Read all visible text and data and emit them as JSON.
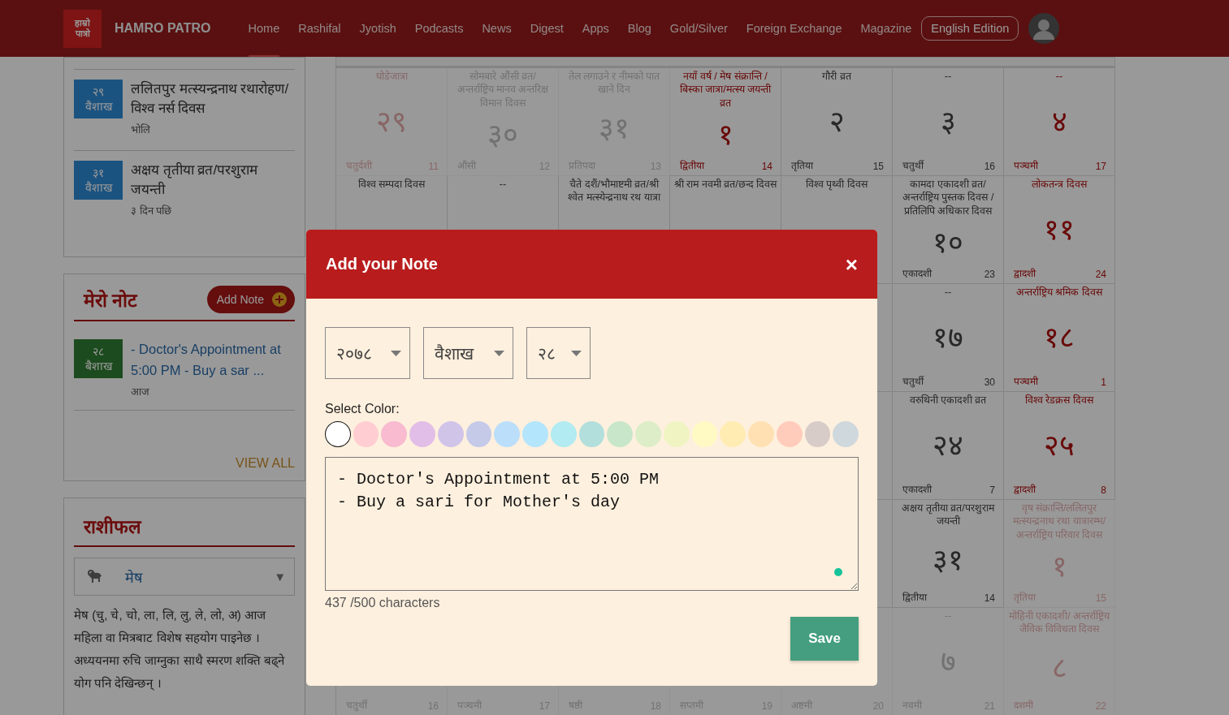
{
  "header": {
    "logo": [
      "हाम्रो",
      "पात्रो"
    ],
    "brand": "HAMRO PATRO",
    "nav": [
      {
        "label": "Home",
        "selected": true
      },
      {
        "label": "Rashifal",
        "selected": false
      },
      {
        "label": "Jyotish",
        "selected": false
      },
      {
        "label": "Podcasts",
        "selected": false
      },
      {
        "label": "News",
        "selected": false
      },
      {
        "label": "Digest",
        "selected": false
      },
      {
        "label": "Apps",
        "selected": false
      },
      {
        "label": "Blog",
        "selected": false
      },
      {
        "label": "Gold/Silver",
        "selected": false
      },
      {
        "label": "Foreign Exchange",
        "selected": false
      },
      {
        "label": "Magazine",
        "selected": false
      }
    ],
    "edition_button": "English Edition"
  },
  "upcoming_events": [
    {
      "day": "२९",
      "month": "वैशाख",
      "title": "ललितपुर मत्स्यन्द्रनाथ रथारोहण/विश्व नर्स दिवस",
      "when": "भोलि"
    },
    {
      "day": "३१",
      "month": "वैशाख",
      "title": "अक्षय तृतीया व्रत/परशुराम जयन्ती",
      "when": "३ दिन पछि"
    }
  ],
  "my_notes": {
    "title": "मेरो नोट",
    "add_button": "Add Note",
    "notes": [
      {
        "day": "२८",
        "month": "बैशाख",
        "text": "- Doctor's Appointment at 5:00 PM - Buy a sar ...",
        "when": "आज"
      }
    ],
    "view_all": "VIEW ALL"
  },
  "rashifal": {
    "title": "राशीफल",
    "sign": "मेष",
    "caret": "▼",
    "text": "मेष (चु, चे, चो, ला, लि, लु, ले, लो, अ) आज महिला वा मित्रबाट विशेष सहयोग पाइनेछ । अध्ययनमा रुचि जाग्नुका साथै स्मरण शक्ति बढ्ने योग पनि देखिन्छन् ।"
  },
  "calendar": {
    "weeks": [
      [
        {
          "event": "घोडेजात्रा",
          "day": "२९",
          "tithi": "चतुर्दशी",
          "eng": "11",
          "other_month": true,
          "holiday": true
        },
        {
          "event": "सोमबारे औंसी व्रत/ अन्तर्राष्ट्रिय मानव अन्तरिक्ष विमान दिवस",
          "day": "३०",
          "tithi": "औंसी",
          "eng": "12",
          "other_month": true,
          "holiday": false
        },
        {
          "event": "तेल लगाउने र नीमको पात खाने दिन",
          "day": "३१",
          "tithi": "प्रतिपदा",
          "eng": "13",
          "other_month": true,
          "holiday": false
        },
        {
          "event": "नयाँ वर्ष / मेष संक्रान्ति / बिस्का जात्रा/मत्स्य जयन्ती व्रत",
          "day": "१",
          "tithi": "द्वितीया",
          "eng": "14",
          "other_month": false,
          "holiday": true
        },
        {
          "event": "गौरी व्रत",
          "day": "२",
          "tithi": "तृतिया",
          "eng": "15",
          "other_month": false,
          "holiday": false
        },
        {
          "event": "--",
          "day": "३",
          "tithi": "चतुर्थी",
          "eng": "16",
          "other_month": false,
          "holiday": false
        },
        {
          "event": "--",
          "day": "४",
          "tithi": "पञ्चमी",
          "eng": "17",
          "other_month": false,
          "holiday": true
        }
      ],
      [
        {
          "event": "विश्व सम्पदा दिवस",
          "other_month": false,
          "holiday": false
        },
        {
          "event": "--",
          "other_month": false,
          "holiday": false
        },
        {
          "event": "चैते दशैं/भौमाष्टमी व्रत/श्री श्वेत मत्स्येन्द्रनाथ रथ यात्रा",
          "other_month": false,
          "holiday": false
        },
        {
          "event": "श्री राम नवमी व्रत/छन्द दिवस",
          "other_month": false,
          "holiday": false
        },
        {
          "event": "विश्व पृथ्वी दिवस",
          "other_month": false,
          "holiday": false
        },
        {
          "event": "कामदा एकादशी व्रत/ अन्तर्राष्ट्रिय पुस्तक दिवस / प्रतिलिपि अधिकार दिवस",
          "day": "१०",
          "tithi": "एकादशी",
          "eng": "23",
          "other_month": false,
          "holiday": false
        },
        {
          "event": "लोकतन्त्र दिवस",
          "day": "११",
          "tithi": "द्वादशी",
          "eng": "24",
          "other_month": false,
          "holiday": true
        }
      ],
      [
        {
          "event": "--",
          "day": "१७",
          "tithi": "चतुर्थी",
          "eng": "30",
          "other_month": false,
          "holiday": false
        },
        {
          "event": "अन्तर्राष्ट्रिय श्रमिक दिवस",
          "day": "१८",
          "tithi": "पञ्चमी",
          "eng": "1",
          "other_month": false,
          "holiday": true
        }
      ],
      [
        {
          "event": "वरुथिनी एकादशी व्रत",
          "day": "२४",
          "tithi": "एकादशी",
          "eng": "7",
          "other_month": false,
          "holiday": false
        },
        {
          "event": "विश्व रेडक्रस दिवस",
          "day": "२५",
          "tithi": "द्वादशी",
          "eng": "8",
          "other_month": false,
          "holiday": true
        }
      ],
      [
        {
          "event": "अक्षय तृतीया व्रत/परशुराम जयन्ती",
          "day": "३१",
          "tithi": "द्वितीया",
          "eng": "14",
          "other_month": false,
          "holiday": false
        },
        {
          "event": "वृष संक्रान्ति/ललितपुर मत्स्यन्द्रनाथ रथा यात्रारम्भ/अन्तर्राष्ट्रिय परिवार दिवस",
          "day": "१",
          "tithi": "तृतिया",
          "eng": "15",
          "other_month": true,
          "holiday": true
        }
      ],
      [
        {
          "tithi": "चतुर्थी",
          "eng": "16",
          "other_month": true,
          "holiday": false
        },
        {
          "tithi": "पञ्चमी",
          "eng": "17",
          "other_month": true,
          "holiday": false
        },
        {
          "tithi": "षष्ठी",
          "eng": "18",
          "other_month": true,
          "holiday": false
        },
        {
          "tithi": "सप्तमी",
          "eng": "19",
          "other_month": true,
          "holiday": false
        },
        {
          "tithi": "अष्टमी",
          "eng": "20",
          "other_month": true,
          "holiday": false
        },
        {
          "event": "--",
          "day": "७",
          "tithi": "नवमी",
          "eng": "21",
          "other_month": true,
          "holiday": false
        },
        {
          "event": "मोहिनी एकादशी/ अन्तर्राष्ट्रिय जैविक विविधता दिवस",
          "day": "८",
          "tithi": "दशमी",
          "eng": "22",
          "other_month": true,
          "holiday": true
        }
      ]
    ]
  },
  "modal": {
    "title": "Add your Note",
    "close": "×",
    "selects": [
      {
        "value": "२०७८"
      },
      {
        "value": "वैशाख"
      },
      {
        "value": "२८"
      }
    ],
    "color_label": "Select Color:",
    "colors": [
      {
        "color": "#ffffff",
        "selected": true
      },
      {
        "color": "#ffcdd2",
        "selected": false
      },
      {
        "color": "#f8bbd0",
        "selected": false
      },
      {
        "color": "#e1bee7",
        "selected": false
      },
      {
        "color": "#d1c4e9",
        "selected": false
      },
      {
        "color": "#c5cae9",
        "selected": false
      },
      {
        "color": "#bbdefb",
        "selected": false
      },
      {
        "color": "#b3e5fc",
        "selected": false
      },
      {
        "color": "#b2ebf2",
        "selected": false
      },
      {
        "color": "#b2dfdb",
        "selected": false
      },
      {
        "color": "#c8e6c9",
        "selected": false
      },
      {
        "color": "#dcedc8",
        "selected": false
      },
      {
        "color": "#f0f4c3",
        "selected": false
      },
      {
        "color": "#fff9c4",
        "selected": false
      },
      {
        "color": "#ffecb3",
        "selected": false
      },
      {
        "color": "#ffe0b2",
        "selected": false
      },
      {
        "color": "#ffccbc",
        "selected": false
      },
      {
        "color": "#d7ccc8",
        "selected": false
      },
      {
        "color": "#cfd8dc",
        "selected": false
      }
    ],
    "note_text": "- Doctor's Appointment at 5:00 PM\n- Buy a sari for Mother's day",
    "counter": "437 /500 characters",
    "save_button": "Save"
  }
}
